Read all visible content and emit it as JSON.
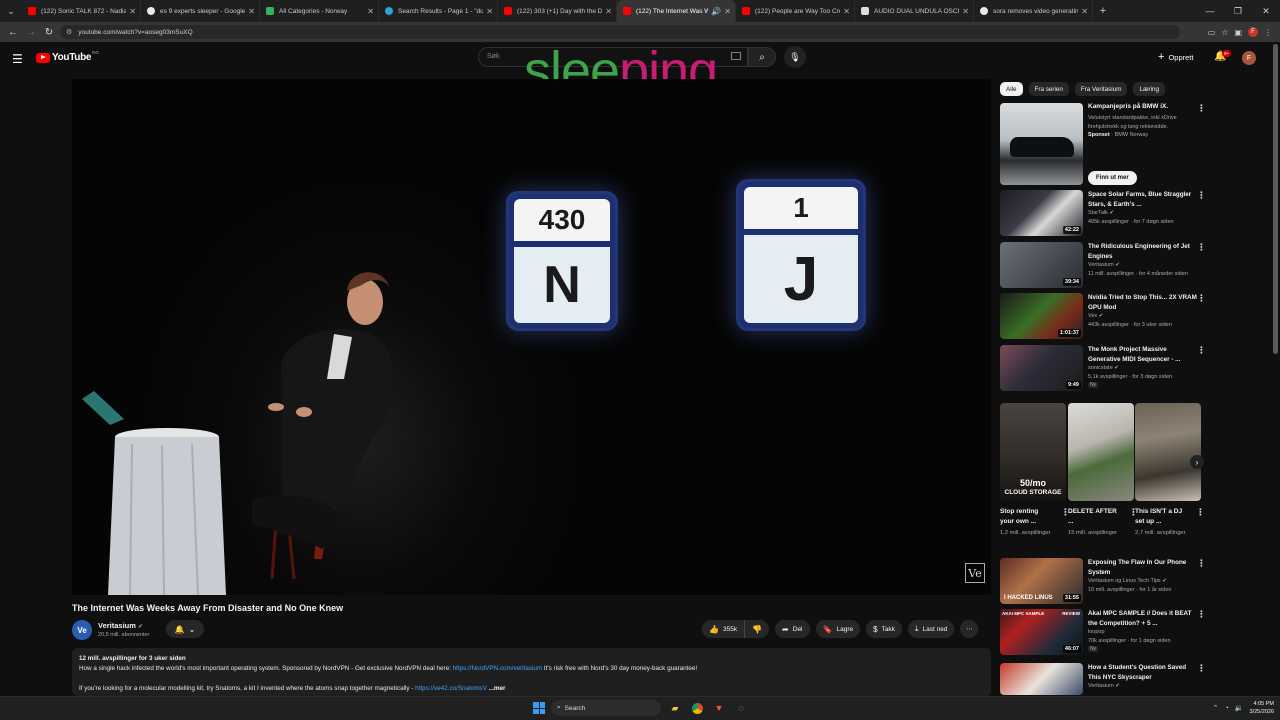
{
  "browser": {
    "tabs": [
      {
        "title": "(122) Sonic TALK 872 - Nadia S",
        "icon_color": "#ff0000"
      },
      {
        "title": "es 9 experts sleeper - Google S",
        "icon_color": "#e8e8e8"
      },
      {
        "title": "All Categories - Norway",
        "icon_color": "#2fb55a"
      },
      {
        "title": "Search Results - Page 1 - \"dual",
        "icon_color": "#2fa0d8"
      },
      {
        "title": "(122) 303 (+1) Day with the DJ",
        "icon_color": "#ff0000"
      },
      {
        "title": "(122) The Internet Was Wee",
        "icon_color": "#ff0000",
        "active": true
      },
      {
        "title": "(122) People are Way Too Crea",
        "icon_color": "#ff0000"
      },
      {
        "title": "AUDIO DUAL UNDULA OSCILL",
        "icon_color": "#dddddd"
      },
      {
        "title": "sora removes video generating",
        "icon_color": "#e8e8e8"
      }
    ],
    "url": "youtube.com/watch?v=aoseg03mSuXQ"
  },
  "header": {
    "logo_text": "YouTube",
    "logo_region": "NO",
    "search_placeholder": "Søk",
    "overlay_text_a": "slee",
    "overlay_text_b": "ping",
    "create_label": "Opprett",
    "notif_count": "9+",
    "avatar_letter": "F"
  },
  "player": {
    "sign1_top": "430",
    "sign1_bottom": "N",
    "sign2_top": "1",
    "sign2_bottom": "J",
    "watermark": "Ve"
  },
  "video": {
    "title": "The Internet Was Weeks Away From Disaster and No One Knew",
    "channel": "Veritasium",
    "channel_initials": "Ve",
    "subscribers": "20,5 mill. abonnenter",
    "likes": "355k",
    "share": "Del",
    "save": "Lagre",
    "thanks": "Takk",
    "download": "Last ned"
  },
  "description": {
    "meta": "12 mill. avspillinger  for 3 uker siden",
    "line1_a": "How a single hack infected the world's most important operating system. Sponsored by NordVPN - Get exclusive NordVPN deal here: ",
    "line1_link": "https://NordVPN.com/veritasium",
    "line1_b": " It's risk free with Nord's 30 day money-back guarantee!",
    "line2_a": "If you're looking for a molecular modelling kit, try Snatoms, a kit I invented where the atoms snap together magnetically - ",
    "line2_link": "https://ve42.co/SnatomsV",
    "more": "...mer"
  },
  "chips": [
    "Alle",
    "Fra serien",
    "Fra Veritasium",
    "Læring"
  ],
  "ad": {
    "title": "Kampanjepris på BMW iX.",
    "desc": "Velutstyrt standardpakke, inkl xDrive firehjulstrekk og lang rekkevidde.",
    "sponsored": "Sponset",
    "advertiser": "BMW Norway",
    "cta": "Finn ut mer"
  },
  "recs": [
    {
      "title": "Space Solar Farms, Blue Straggler Stars, & Earth's ...",
      "channel": "StarTalk",
      "meta": "405k avspillinger · for 7 døgn siden",
      "duration": "42:22",
      "verified": true
    },
    {
      "title": "The Ridiculous Engineering of Jet Engines",
      "channel": "Veritasium",
      "meta": "11 mill. avspillinger · for 4 måneder siden",
      "duration": "39:34",
      "verified": true
    },
    {
      "title": "Nvidia Tried to Stop This... 2X VRAM GPU Mod",
      "channel": "Vex",
      "meta": "443k avspillinger · for 3 uker siden",
      "duration": "1:01:37",
      "verified": true
    },
    {
      "title": "The Monk Project Massive Generative MIDI Sequencer - ...",
      "channel": "sonicstate",
      "meta": "5,1k avspillinger · for 3 døgn siden",
      "duration": "9:49",
      "verified": true,
      "badge": "Ny"
    }
  ],
  "shorts": [
    {
      "title": "Stop renting your own ...",
      "views": "1,2 mill. avspillinger",
      "overlay_a": "50/mo",
      "overlay_b": "CLOUD STORAGE"
    },
    {
      "title": "DELETE AFTER ...",
      "views": "15 mill. avspillinger"
    },
    {
      "title": "This ISN'T a DJ set up ...",
      "views": "2,7 mill. avspillinger"
    }
  ],
  "recs2": [
    {
      "title": "Exposing The Flaw In Our Phone System",
      "channel": "Veritasium og Linus Tech Tips",
      "meta": "10 mill. avspillinger · for 1 år siden",
      "duration": "31:55",
      "thumb_text": "I HACKED LINUS"
    },
    {
      "title": "Akai MPC SAMPLE // Does it BEAT the Competition? + 5 ...",
      "channel": "loopop",
      "meta": "70k avspillinger · for 1 døgn siden",
      "duration": "46:07",
      "thumb_text_a": "AKAI MPC SAMPLE",
      "thumb_text_b": "REVIEW",
      "badge": "Ny"
    },
    {
      "title": "How a Student's Question Saved This NYC Skyscraper",
      "channel": "Veritasium",
      "meta": "",
      "duration": ""
    }
  ],
  "taskbar": {
    "search": "Search",
    "time": "4:05 PM",
    "date": "3/25/2026"
  },
  "colors": {
    "bg": "#0f0f0f",
    "accent_red": "#ff0000",
    "link": "#3ea6ff",
    "overlay_green": "#3ea34a",
    "overlay_pink": "#c81d72"
  }
}
